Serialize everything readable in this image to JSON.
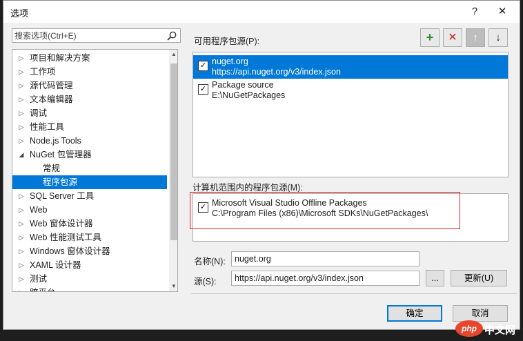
{
  "window": {
    "title": "选项",
    "help_label": "?",
    "close_label": "✕"
  },
  "search": {
    "placeholder": "搜索选项(Ctrl+E)"
  },
  "tree": {
    "items": [
      {
        "label": "项目和解决方案",
        "expanded": false
      },
      {
        "label": "工作项",
        "expanded": false
      },
      {
        "label": "源代码管理",
        "expanded": false
      },
      {
        "label": "文本编辑器",
        "expanded": false
      },
      {
        "label": "调试",
        "expanded": false
      },
      {
        "label": "性能工具",
        "expanded": false
      },
      {
        "label": "Node.js Tools",
        "expanded": false
      },
      {
        "label": "NuGet 包管理器",
        "expanded": true
      },
      {
        "label": "常规",
        "child": true
      },
      {
        "label": "程序包源",
        "child": true,
        "selected": true
      },
      {
        "label": "SQL Server 工具",
        "expanded": false
      },
      {
        "label": "Web",
        "expanded": false
      },
      {
        "label": "Web 窗体设计器",
        "expanded": false
      },
      {
        "label": "Web 性能测试工具",
        "expanded": false
      },
      {
        "label": "Windows 窗体设计器",
        "expanded": false
      },
      {
        "label": "XAML 设计器",
        "expanded": false
      },
      {
        "label": "测试",
        "expanded": false
      },
      {
        "label": "跨平台",
        "expanded": false
      }
    ]
  },
  "available": {
    "label": "可用程序包源(P):",
    "sources": [
      {
        "name": "nuget.org",
        "url": "https://api.nuget.org/v3/index.json",
        "checked": true,
        "selected": true
      },
      {
        "name": "Package source",
        "url": "E:\\NuGetPackages",
        "checked": true,
        "selected": false
      }
    ],
    "toolbar": {
      "add": "+",
      "remove": "✕",
      "up": "↑",
      "down": "↓"
    }
  },
  "machine": {
    "label": "计算机范围内的程序包源(M):",
    "sources": [
      {
        "name": "Microsoft Visual Studio Offline Packages",
        "url": "C:\\Program Files (x86)\\Microsoft SDKs\\NuGetPackages\\",
        "checked": true
      }
    ]
  },
  "form": {
    "name_label": "名称(N):",
    "name_value": "nuget.org",
    "source_label": "源(S):",
    "source_value": "https://api.nuget.org/v3/index.json",
    "browse_label": "...",
    "update_label": "更新(U)"
  },
  "buttons": {
    "ok": "确定",
    "cancel": "取消"
  },
  "watermark": {
    "text": "中文网",
    "brand": "php"
  },
  "colors": {
    "accent": "#0078d7",
    "add_green": "#2e8b2e",
    "remove_red": "#c42b1c",
    "highlight_box": "#e02020"
  }
}
